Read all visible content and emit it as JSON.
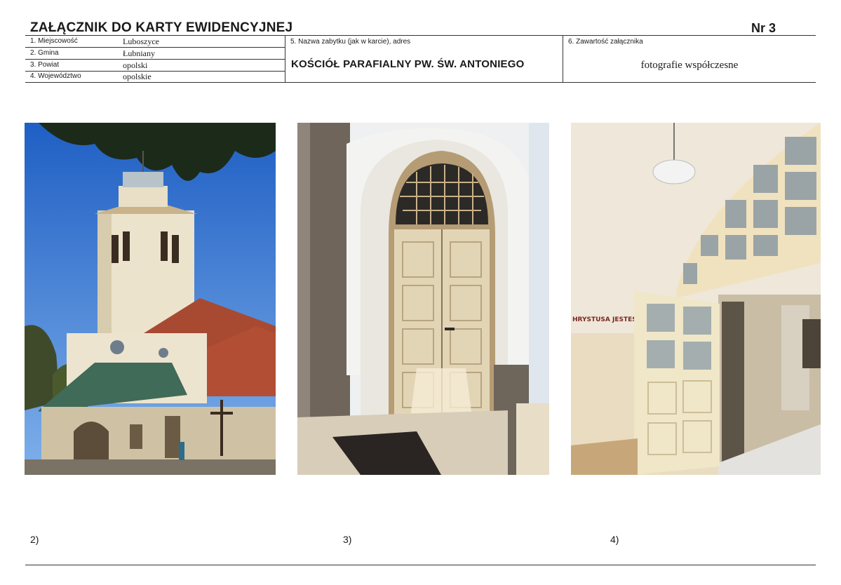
{
  "header": {
    "title": "ZAŁĄCZNIK DO KARTY EWIDENCYJNEJ",
    "number": "Nr 3"
  },
  "fields": [
    {
      "label": "1. Miejscowość",
      "value": "Luboszyce"
    },
    {
      "label": "2. Gmina",
      "value": "Łubniany"
    },
    {
      "label": "3. Powiat",
      "value": "opolski"
    },
    {
      "label": "4. Województwo",
      "value": "opolskie"
    }
  ],
  "monument": {
    "label": "5. Nazwa zabytku (jak w karcie), adres",
    "name": "KOŚCIÓŁ PARAFIALNY PW. ŚW. ANTONIEGO"
  },
  "attachment": {
    "label": "6. Zawartość załącznika",
    "value": "fotografie współczesne"
  },
  "photos": [
    {
      "caption": "2)",
      "subject": "church-exterior-tower"
    },
    {
      "caption": "3)",
      "subject": "arched-entrance-door"
    },
    {
      "caption": "4)",
      "subject": "interior-glazed-door",
      "inscription": "HRYSTUSA JESTEŚ WE M"
    }
  ]
}
